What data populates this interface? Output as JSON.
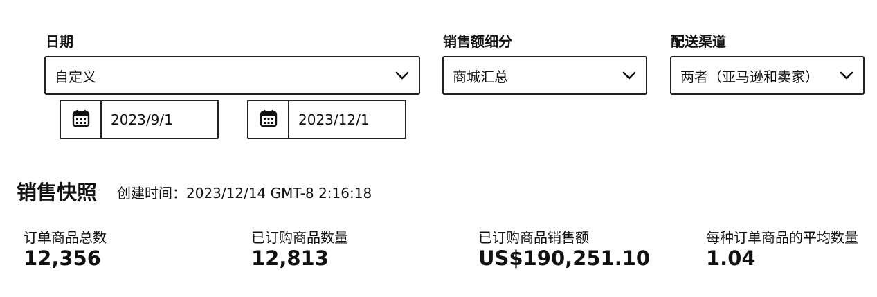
{
  "filters": {
    "date": {
      "label": "日期",
      "selected": "自定义"
    },
    "sales_breakdown": {
      "label": "销售额细分",
      "selected": "商城汇总"
    },
    "fulfillment": {
      "label": "配送渠道",
      "selected": "两者（亚马逊和卖家）"
    },
    "start_date": "2023/9/1",
    "end_date": "2023/12/1"
  },
  "snapshot": {
    "title": "销售快照",
    "created": "创建时间：2023/12/14 GMT-8 2:16:18",
    "metrics": [
      {
        "label": "订单商品总数",
        "value": "12,356"
      },
      {
        "label": "已订购商品数量",
        "value": "12,813"
      },
      {
        "label": "已订购商品销售额",
        "value": "US$190,251.10"
      },
      {
        "label": "每种订单商品的平均数量",
        "value": "1.04"
      }
    ]
  },
  "icons": {
    "dropdown": "chevron-down-icon",
    "calendar": "calendar-icon"
  }
}
